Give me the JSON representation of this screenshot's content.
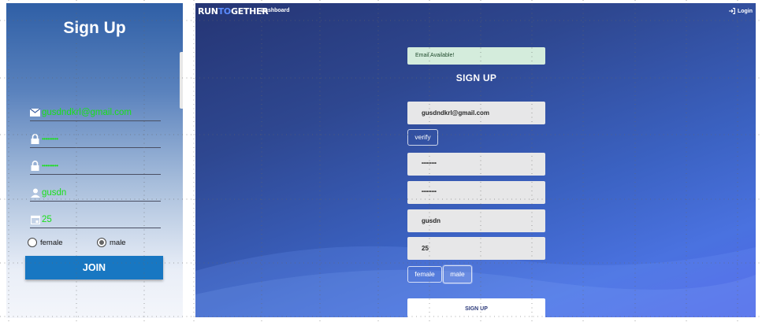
{
  "mobile": {
    "title": "Sign Up",
    "email_value": "gusdndkrl@gmail.com",
    "password_value": "•••••••••",
    "password_confirm_value": "•••••••••",
    "name_value": "gusdn",
    "age_value": "25",
    "gender_female_label": "female",
    "gender_male_label": "male",
    "selected_gender": "male",
    "join_label": "JOIN",
    "accent_color": "#1877c2",
    "value_color": "#19e019"
  },
  "web": {
    "logo_run": "RUN",
    "logo_to": "TO",
    "logo_gether": "GETHER",
    "nav_dashboard": "Dashboard",
    "nav_login": "Login",
    "alert_text": "Email Available!",
    "title": "SIGN UP",
    "email_value": "gusdndkrl@gmail.com",
    "verify_label": "verify",
    "password_value": "•••••••••",
    "password_confirm_value": "•••••••••",
    "name_value": "gusdn",
    "age_value": "25",
    "gender_female_label": "female",
    "gender_male_label": "male",
    "selected_gender": "male",
    "submit_label": "SIGN UP"
  }
}
